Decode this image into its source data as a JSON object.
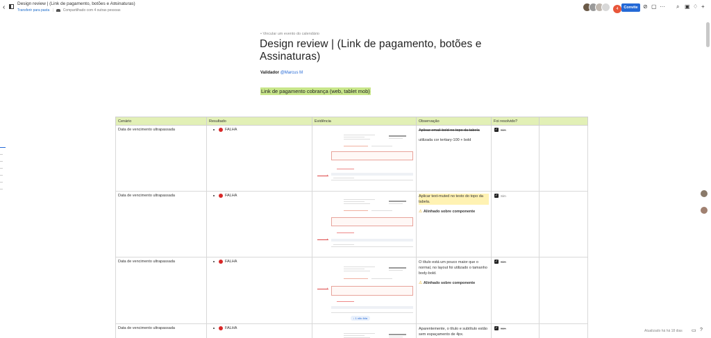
{
  "topbar": {
    "title": "Design review | (Link de pagamento, botões e Assinaturas)",
    "transfer_label": "Transferir para pasta",
    "shared_label": "Compartilhado com 4 outras pessoas",
    "avatar_count": "4",
    "invite_label": "Convite"
  },
  "page": {
    "calendar_link": "• Vincular um evento do calendário",
    "title": "Design review | (Link de pagamento, botões e Assinaturas)",
    "validator_label": "Validador",
    "validator_mention": "@Marcus M",
    "section_heading": "Link de pagamento cobrança (web, tablet mob)"
  },
  "table": {
    "headers": [
      "Cenário",
      "Resultado",
      "Evidência",
      "Observação",
      "Foi resolvido?",
      ""
    ],
    "rows": [
      {
        "cenario": "Data de vencimento ultrapassada",
        "resultado": "FALHA",
        "obs_strike": "Aplicar email-bold no topo da tabela",
        "obs_text": "utilizada cor tertiary-100 + bold",
        "obs_warn": "",
        "resolvido": "Sim"
      },
      {
        "cenario": "Data de vencimento ultrapassada",
        "resultado": "FALHA",
        "obs_strike": "",
        "obs_text": "Aplicar text-muted no texto do topo da tabela.",
        "obs_warn": "Alinhado sobre componente",
        "resolvido": "Sim"
      },
      {
        "cenario": "Data de vencimento ultrapassada",
        "resultado": "FALHA",
        "obs_strike": "",
        "obs_text": "O título está um pouco maior que o normal, no layout foi utilizado o tamanho body-bold.",
        "obs_warn": "Alinhado sobre componente",
        "resolvido": "Sim",
        "evidence_button": "↓ 1 não lida"
      },
      {
        "cenario": "Data de vencimento ultrapassada",
        "resultado": "FALHA",
        "obs_strike": "",
        "obs_text": "Aparentemente, o título e subtítulo estão sem espaçamento de 4px.",
        "obs_warn": "",
        "resolvido": "Sim"
      }
    ]
  },
  "footer": {
    "updated": "Atualizado há há 18 dias"
  },
  "colors": {
    "accent": "#2469d6",
    "header_bg": "#e2f0b6",
    "highlight": "#c8e68a",
    "fail": "#d82828"
  },
  "icons": [
    "back-icon",
    "sidebar-toggle-icon",
    "chevron-icon",
    "link-icon",
    "comment-icon",
    "more-icon",
    "search-icon",
    "edit-icon",
    "bell-icon",
    "plus-icon",
    "check-icon",
    "warning-icon"
  ]
}
